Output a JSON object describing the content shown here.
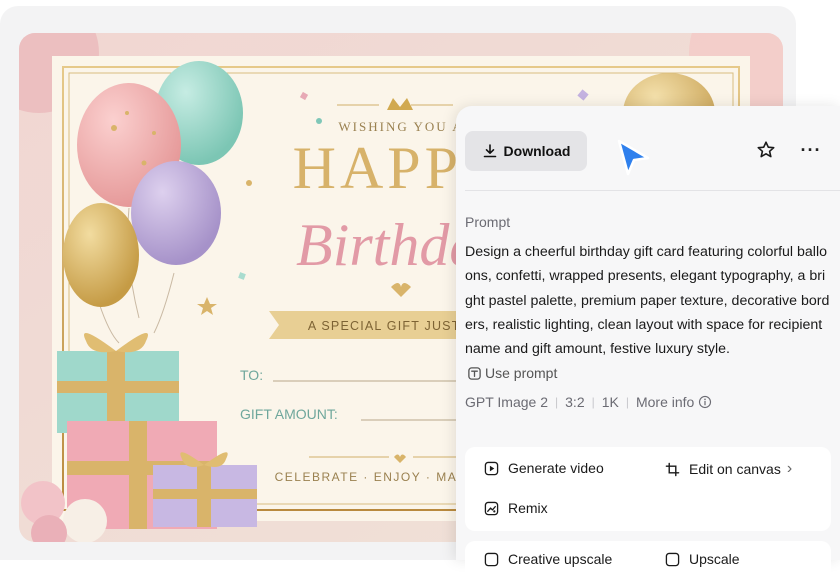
{
  "card": {
    "wishing": "WISHING YOU A",
    "happy": "HAPPY",
    "birthday": "Birthday",
    "ribbon": "A SPECIAL GIFT JUST FOR YOU",
    "to_label": "TO:",
    "gift_label": "GIFT AMOUNT:",
    "footer": "CELEBRATE · ENJOY · MAKE A WISH"
  },
  "panel": {
    "download_label": "Download",
    "more_label": "···",
    "prompt_label": "Prompt",
    "prompt_text": "Design a cheerful birthday gift card featuring colorful balloons, confetti, wrapped presents, elegant typography, a bright pastel palette, premium paper texture, decorative borders, realistic lighting, clean layout with space for recipient name and gift amount, festive luxury style.",
    "use_prompt_label": "Use prompt",
    "meta": {
      "model": "GPT Image 2",
      "ratio": "3:2",
      "size": "1K",
      "more_info": "More info"
    },
    "actions": {
      "generate_video": "Generate video",
      "edit_on_canvas": "Edit on canvas",
      "edit_chevron": "›",
      "remix": "Remix",
      "creative_upscale": "Creative upscale",
      "upscale": "Upscale"
    }
  },
  "colors": {
    "accent_cursor": "#2f80ed",
    "gold": "#c9a24a",
    "pink": "#e6a3ae",
    "teal": "#7fc7b8"
  }
}
